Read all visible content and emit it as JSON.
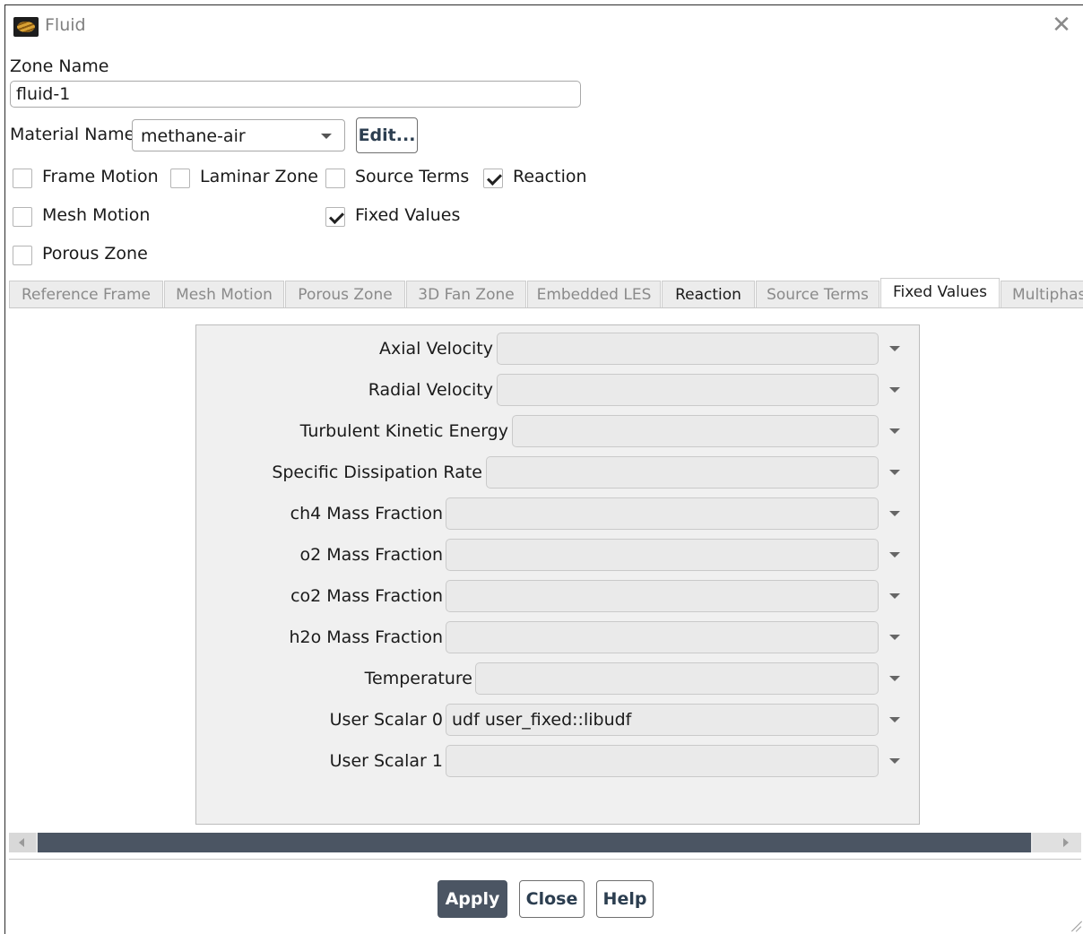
{
  "window": {
    "title": "Fluid",
    "close_glyph": "✕"
  },
  "zone": {
    "label": "Zone Name",
    "value": "fluid-1"
  },
  "material": {
    "label": "Material Name",
    "value": "methane-air",
    "edit_label": "Edit..."
  },
  "options": {
    "frame_motion": {
      "label": "Frame Motion",
      "checked": false
    },
    "laminar_zone": {
      "label": "Laminar Zone",
      "checked": false
    },
    "source_terms": {
      "label": "Source Terms",
      "checked": false
    },
    "reaction": {
      "label": "Reaction",
      "checked": true
    },
    "mesh_motion": {
      "label": "Mesh Motion",
      "checked": false
    },
    "fixed_values": {
      "label": "Fixed Values",
      "checked": true
    },
    "porous_zone": {
      "label": "Porous Zone",
      "checked": false
    }
  },
  "tabs": [
    {
      "label": "Reference Frame"
    },
    {
      "label": "Mesh Motion"
    },
    {
      "label": "Porous Zone"
    },
    {
      "label": "3D Fan Zone"
    },
    {
      "label": "Embedded LES"
    },
    {
      "label": "Reaction"
    },
    {
      "label": "Source Terms"
    },
    {
      "label": "Fixed Values"
    },
    {
      "label": "Multiphase"
    }
  ],
  "active_tab": "Fixed Values",
  "fixed_values": [
    {
      "label": "Axial Velocity",
      "value": ""
    },
    {
      "label": "Radial Velocity",
      "value": ""
    },
    {
      "label": "Turbulent Kinetic Energy",
      "value": ""
    },
    {
      "label": "Specific Dissipation Rate",
      "value": ""
    },
    {
      "label": "ch4 Mass Fraction",
      "value": ""
    },
    {
      "label": "o2 Mass Fraction",
      "value": ""
    },
    {
      "label": "co2 Mass Fraction",
      "value": ""
    },
    {
      "label": "h2o Mass Fraction",
      "value": ""
    },
    {
      "label": "Temperature",
      "value": ""
    },
    {
      "label": "User Scalar 0",
      "value": "udf user_fixed::libudf"
    },
    {
      "label": "User Scalar 1",
      "value": ""
    }
  ],
  "buttons": {
    "apply": "Apply",
    "close": "Close",
    "help": "Help"
  }
}
